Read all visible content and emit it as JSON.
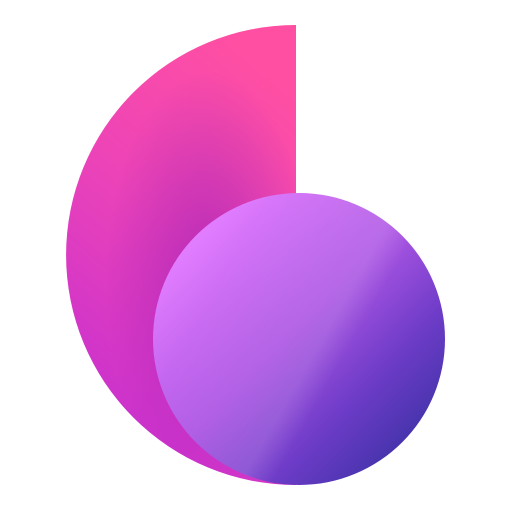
{
  "logo": {
    "icon": "abstract-shell-logo-icon",
    "colors": {
      "shell_top": "#ff4fa3",
      "shell_mid": "#e43fc0",
      "shell_shadow": "#a522c7",
      "sphere_highlight": "#dd7cff",
      "sphere_mid": "#a550e0",
      "sphere_dark": "#4a34b0"
    }
  }
}
